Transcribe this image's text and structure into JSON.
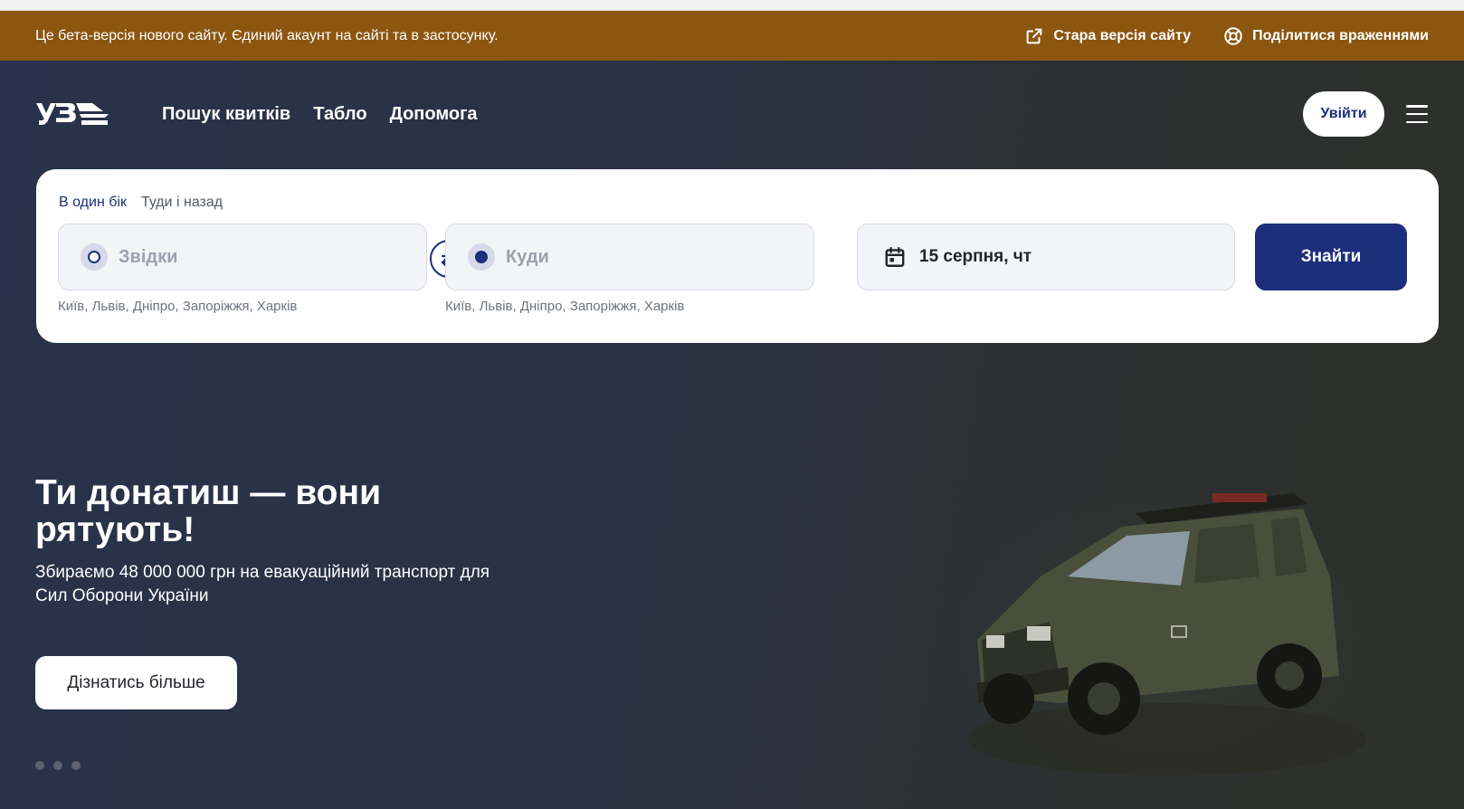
{
  "beta_banner": {
    "message": "Це бета-версія нового сайту. Єдиний акаунт на сайті та в застосунку.",
    "old_version_label": "Стара версія сайту",
    "feedback_label": "Поділитися враженнями"
  },
  "nav": {
    "logo_text": "УЗ",
    "items": [
      "Пошук квитків",
      "Табло",
      "Допомога"
    ],
    "login_label": "Увійти"
  },
  "search": {
    "tabs": [
      {
        "label": "В один бік",
        "active": true
      },
      {
        "label": "Туди і назад",
        "active": false
      }
    ],
    "from_placeholder": "Звідки",
    "to_placeholder": "Куди",
    "from_hints": "Київ, Львів, Дніпро, Запоріжжя, Харків",
    "to_hints": "Київ, Львів, Дніпро, Запоріжжя, Харків",
    "date_value": "15 серпня, чт",
    "submit_label": "Знайти"
  },
  "promo": {
    "title": "Ти донатиш — вони рятують!",
    "subtitle": "Збираємо 48 000 000 грн на евакуаційний транспорт для Сил Оборони України",
    "cta_label": "Дізнатись більше",
    "slide_count": 3
  },
  "colors": {
    "beta_bg": "#8b5610",
    "brand_blue": "#1d2e7b",
    "hero_bg": "#2a323f"
  }
}
